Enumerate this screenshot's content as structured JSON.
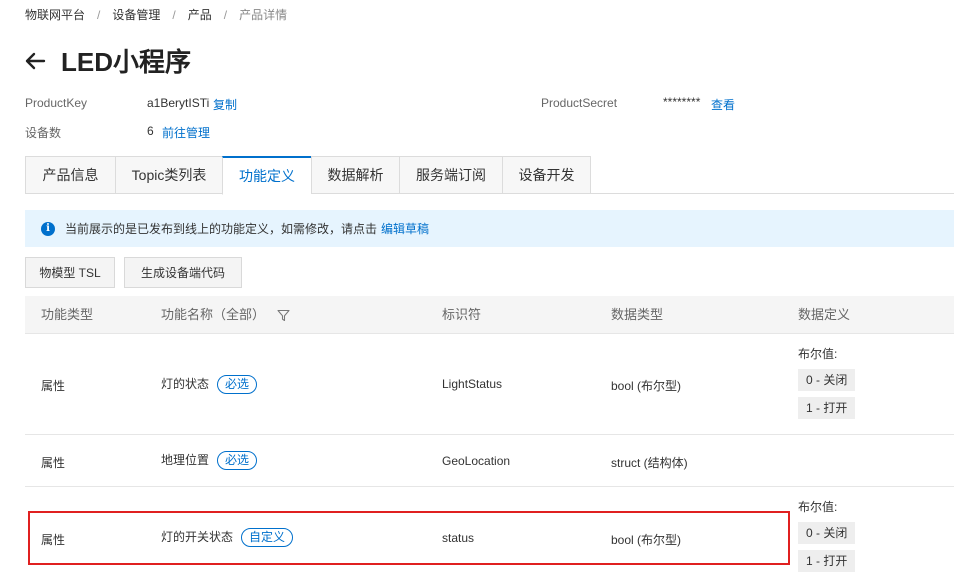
{
  "breadcrumb": [
    "物联网平台",
    "设备管理",
    "产品",
    "产品详情"
  ],
  "page": {
    "title": "LED小程序"
  },
  "meta": {
    "product_key_label": "ProductKey",
    "product_key_value": "a1BerytISTi",
    "copy_link": "复制",
    "device_count_label": "设备数",
    "device_count_value": "6",
    "manage_link": "前往管理",
    "product_secret_label": "ProductSecret",
    "product_secret_value": "********",
    "view_link": "查看"
  },
  "tabs": [
    {
      "label": "产品信息",
      "active": false
    },
    {
      "label": "Topic类列表",
      "active": false
    },
    {
      "label": "功能定义",
      "active": true
    },
    {
      "label": "数据解析",
      "active": false
    },
    {
      "label": "服务端订阅",
      "active": false
    },
    {
      "label": "设备开发",
      "active": false
    }
  ],
  "notice": {
    "text": "当前展示的是已发布到线上的功能定义，如需修改，请点击",
    "link": "编辑草稿"
  },
  "buttons": {
    "tsl": "物模型 TSL",
    "generate": "生成设备端代码"
  },
  "table": {
    "headers": {
      "type": "功能类型",
      "name": "功能名称（全部）",
      "identifier": "标识符",
      "data_type": "数据类型",
      "data_def": "数据定义"
    },
    "rows": [
      {
        "type": "属性",
        "name": "灯的状态",
        "badge": "必选",
        "identifier": "LightStatus",
        "data_type": "bool (布尔型)",
        "bool_title": "布尔值:",
        "bool_values": [
          "0 - 关闭",
          "1 - 打开"
        ]
      },
      {
        "type": "属性",
        "name": "地理位置",
        "badge": "必选",
        "identifier": "GeoLocation",
        "data_type": "struct (结构体)"
      },
      {
        "type": "属性",
        "name": "灯的开关状态",
        "badge": "自定义",
        "identifier": "status",
        "data_type": "bool (布尔型)",
        "bool_title": "布尔值:",
        "bool_values": [
          "0 - 关闭",
          "1 - 打开"
        ]
      }
    ]
  },
  "colors": {
    "accent": "#0070cc",
    "highlight": "#e02020",
    "notice_bg": "#e6f4fe"
  }
}
